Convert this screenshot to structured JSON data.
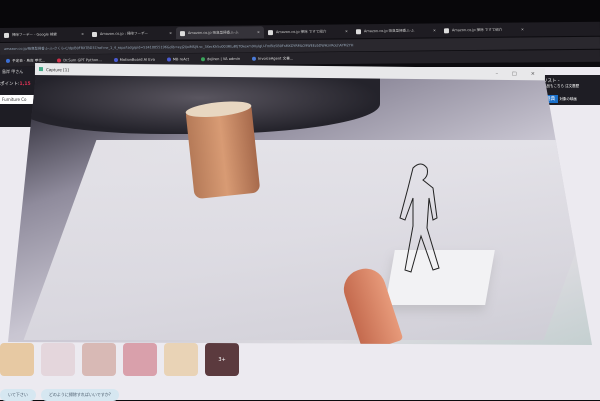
{
  "browser": {
    "tabs": [
      {
        "label": "掃除フーデー - Google 検索",
        "active": false
      },
      {
        "label": "Amazon.co.jp : 掃除フーデー",
        "active": false
      },
      {
        "label": "Amazon.co.jp 吸臭型掃香ふ-ふ",
        "active": true
      },
      {
        "label": "Amazon.co.jp 掃除 ですて紹介",
        "active": false
      },
      {
        "label": "Amazon.co.jp 吸臭型掃香ふ-ふ",
        "active": false
      },
      {
        "label": "Amazon.co.jp 掃除 ですて紹介",
        "active": false
      }
    ],
    "address": "amazon.co.jp/吸臭型掃香ふ-ふ-さくら-C/dp/B0FRXTBD37/ref=sr_1_4_sspa?adgrpid=53410055196&dib=eyJ2IjoiMSJ9.sc_3XecKh5o003RtuBtjT0kexm9VyIgU-FmBlz5B0FsMXDYRMLO9WEEzbDWHznRoLhAYM2YH",
    "bookmarks": [
      {
        "label": "予定表 - 島岸 甲代...",
        "color": "#3b6fd6"
      },
      {
        "label": "Dr.Sum GPT Python...",
        "color": "#d0304a"
      },
      {
        "label": "MotionBoard AI Eva",
        "color": "#4a5ad0"
      },
      {
        "label": "MB reAct",
        "color": "#4a5ad0"
      },
      {
        "label": "dejiren | VA admin",
        "color": "#3aa45a"
      },
      {
        "label": "InvoiceAgent 文書...",
        "color": "#4a7ad6"
      }
    ]
  },
  "page": {
    "side_text": "島岸 甲さん",
    "points_label": "ポイント:",
    "points_value": "1,15",
    "furniture": "Furniture Co",
    "right_nav": "リスト -",
    "right_nav2": "返品もこちら 注文履歴",
    "tokka": "特典",
    "tokka2": "対象の映画",
    "more_thumbs": "3+",
    "chips": [
      "いて下さい",
      "どのように掃除すればいいですか?"
    ]
  },
  "capture": {
    "title": "Capture [1]",
    "minimize": "–",
    "maximize": "□",
    "close": "✕"
  }
}
